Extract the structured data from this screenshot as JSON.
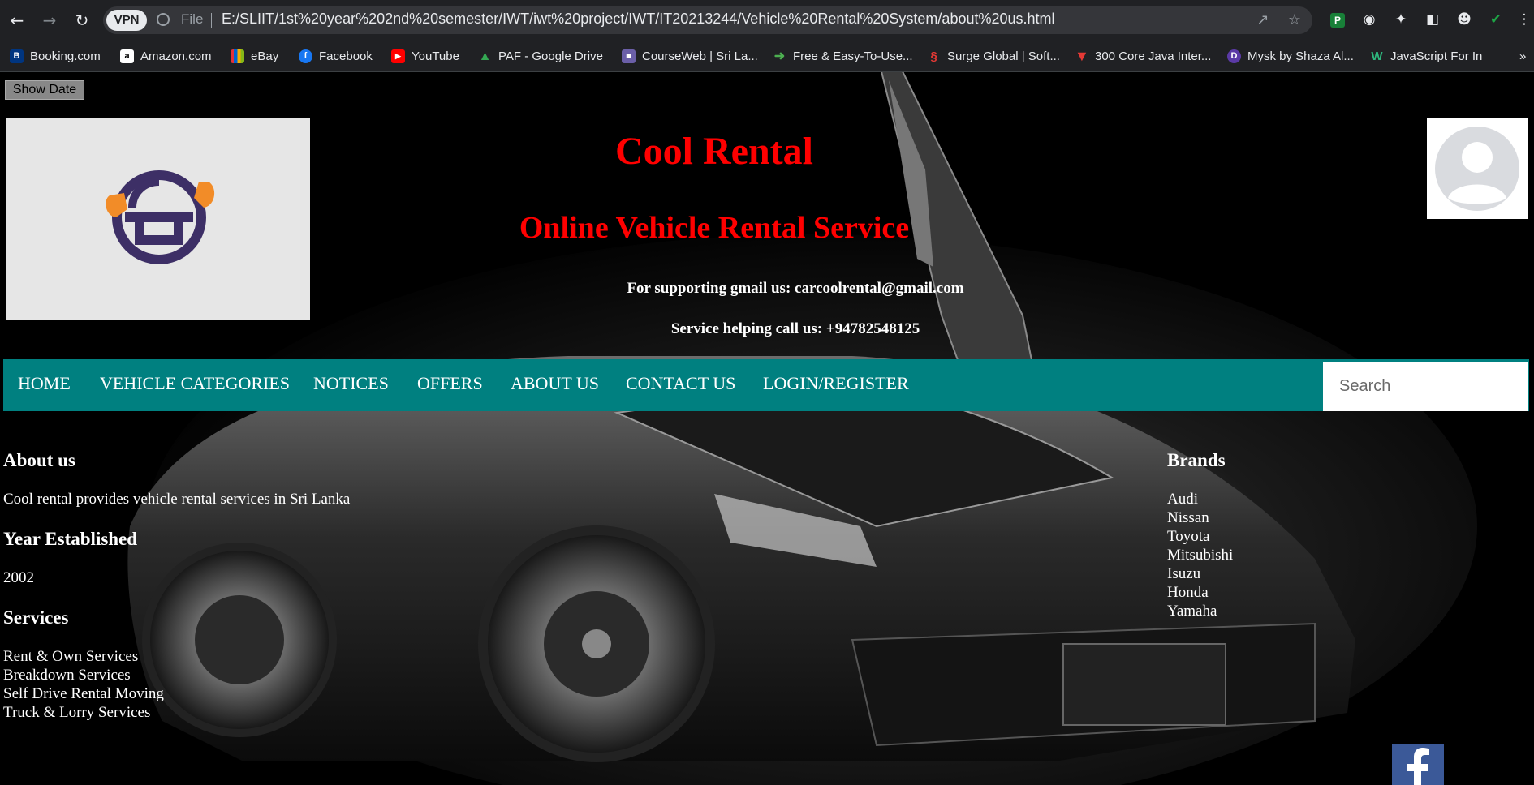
{
  "browser": {
    "vpn_label": "VPN",
    "scheme_label": "File",
    "url": "E:/SLIIT/1st%20year%202nd%20semester/IWT/iwt%20project/IWT/IT20213244/Vehicle%20Rental%20System/about%20us.html",
    "bookmarks": [
      {
        "label": "Booking.com",
        "icon": "booking-icon",
        "color": "#003580"
      },
      {
        "label": "Amazon.com",
        "icon": "amazon-icon",
        "color": "#ffffff"
      },
      {
        "label": "eBay",
        "icon": "ebay-icon",
        "color": "#e53238"
      },
      {
        "label": "Facebook",
        "icon": "facebook-icon",
        "color": "#1877f2"
      },
      {
        "label": "YouTube",
        "icon": "youtube-icon",
        "color": "#ff0000"
      },
      {
        "label": "PAF - Google Drive",
        "icon": "google-drive-icon",
        "color": "#34a853"
      },
      {
        "label": "CourseWeb | Sri La...",
        "icon": "courseweb-icon",
        "color": "#6b5fa8"
      },
      {
        "label": "Free & Easy-To-Use...",
        "icon": "free-tool-icon",
        "color": "#4caf50"
      },
      {
        "label": "Surge Global | Soft...",
        "icon": "surge-icon",
        "color": "#e53935"
      },
      {
        "label": "300 Core Java Inter...",
        "icon": "java-icon",
        "color": "#e53935"
      },
      {
        "label": "Mysk by Shaza Al...",
        "icon": "mysk-icon",
        "color": "#5b3aa6"
      },
      {
        "label": "JavaScript For In",
        "icon": "javascript-icon",
        "color": "#2eb67d"
      }
    ]
  },
  "page": {
    "show_date_label": "Show Date",
    "title": "Cool Rental",
    "subtitle": "Online Vehicle Rental Service",
    "support_email": "For supporting gmail us: carcoolrental@gmail.com",
    "support_phone": "Service helping call us: +94782548125",
    "nav": [
      "HOME",
      "VEHICLE CATEGORIES",
      "NOTICES",
      "OFFERS",
      "ABOUT US",
      "CONTACT US",
      "LOGIN/REGISTER"
    ],
    "search_placeholder": "Search",
    "about": {
      "heading": "About us",
      "text": "Cool rental provides vehicle rental services in Sri Lanka",
      "year_heading": "Year Established",
      "year": "2002",
      "services_heading": "Services",
      "services": [
        "Rent & Own Services",
        "Breakdown Services",
        "Self Drive Rental Moving",
        "Truck & Lorry Services"
      ]
    },
    "brands": {
      "heading": "Brands",
      "items": [
        "Audi",
        "Nissan",
        "Toyota",
        "Mitsubishi",
        "Isuzu",
        "Honda",
        "Yamaha"
      ]
    },
    "colors": {
      "title": "#ff0000",
      "navbar": "#008080",
      "logo_orange": "#f28c28",
      "logo_purple": "#3d2f66"
    }
  }
}
